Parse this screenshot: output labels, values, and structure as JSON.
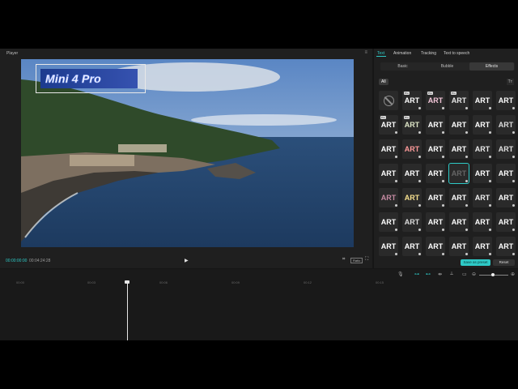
{
  "player": {
    "title": "Player",
    "overlay_text": "Mini 4 Pro",
    "time_current": "00:00:00:00",
    "time_total": "00:04:24:28",
    "ratio_label": "Ratio"
  },
  "panel": {
    "tabs": [
      "Text",
      "Animation",
      "Tracking",
      "Text to speech"
    ],
    "active_tab": "Text",
    "subtabs": [
      "Basic",
      "Bubble",
      "Effects"
    ],
    "active_subtab": "Effects",
    "filter_all": "All",
    "effect_label": "ART",
    "pro_badge": "Pro",
    "save_button": "Save as preset",
    "reset_button": "Reset"
  },
  "timeline": {
    "ruler_ticks": [
      "00:00",
      "00:03",
      "00:06",
      "00:09",
      "00:12",
      "00:15"
    ]
  },
  "colors": {
    "accent": "#2ec9c6",
    "panel_bg": "#1f1f1f",
    "overlay_bg": "#1c3b8e"
  },
  "icons": {
    "menu": "menu-icon",
    "play": "play-icon",
    "fullscreen": "fullscreen-icon",
    "none": "none-effect-icon",
    "download": "download-icon",
    "mic": "microphone-icon",
    "link": "link-icon",
    "split": "split-icon",
    "zoom_out": "zoom-out-icon",
    "zoom_in": "zoom-in-icon"
  }
}
